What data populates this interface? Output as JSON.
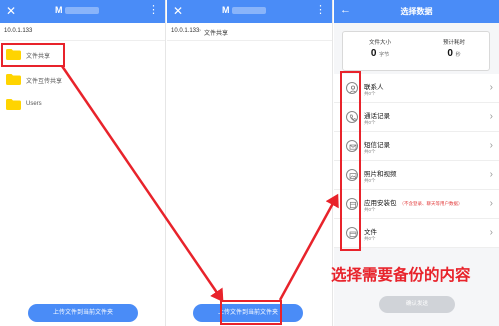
{
  "panel1": {
    "title": "M",
    "breadcrumb": [
      "10.0.1.133"
    ],
    "folders": [
      {
        "name": "文件共享"
      },
      {
        "name": "文件互传共享"
      },
      {
        "name": "Users"
      }
    ],
    "upload_button": "上传文件到当前文件夹"
  },
  "panel2": {
    "title": "M",
    "breadcrumb": [
      "10.0.1.133",
      "文件共享"
    ],
    "upload_button": "上传文件到当前文件夹"
  },
  "panel3": {
    "title": "选择数据",
    "summary": {
      "size_caption": "文件大小",
      "size_value": "0",
      "size_unit": "字节",
      "time_caption": "预计耗时",
      "time_value": "0",
      "time_unit": "秒"
    },
    "items": [
      {
        "name": "联系人",
        "count": "共0个",
        "note": "",
        "icon": "contact-icon"
      },
      {
        "name": "通话记录",
        "count": "共0个",
        "note": "",
        "icon": "phone-icon"
      },
      {
        "name": "短信记录",
        "count": "共0个",
        "note": "",
        "icon": "message-icon"
      },
      {
        "name": "照片和视频",
        "count": "共0个",
        "note": "",
        "icon": "photo-icon"
      },
      {
        "name": "应用安装包",
        "count": "共0个",
        "note": "（不含登录、聊天等用户数据）",
        "icon": "app-package-icon"
      },
      {
        "name": "文件",
        "count": "共0个",
        "note": "",
        "icon": "file-icon"
      }
    ],
    "confirm_button": "确认发送"
  },
  "annotation": "选择需要备份的内容",
  "colors": {
    "topbar": "#4a8cf7",
    "accent_red": "#e8232b",
    "folder_yellow": "#ffd400"
  }
}
